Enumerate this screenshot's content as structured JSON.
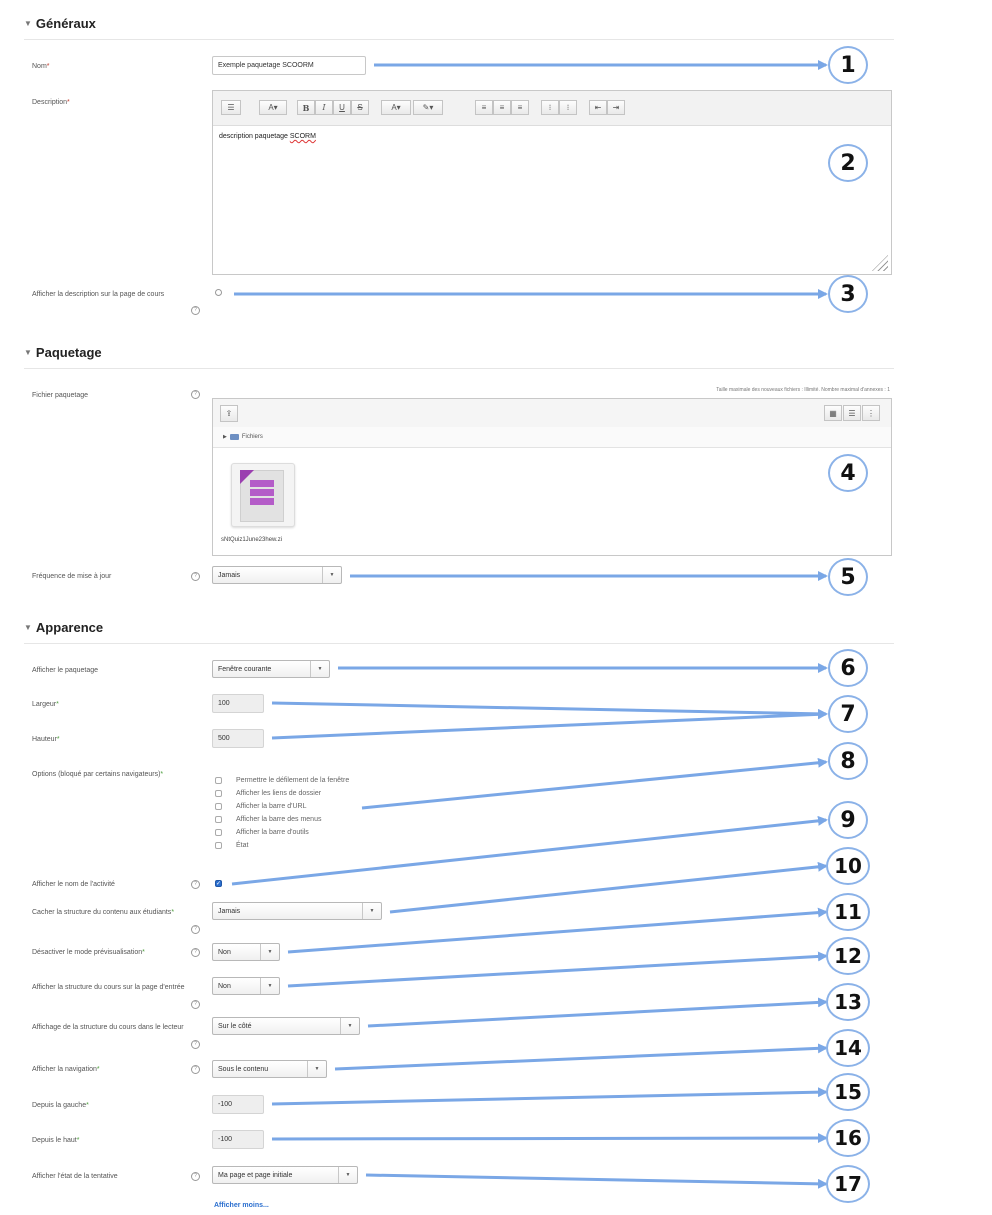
{
  "sections": {
    "generaux": "Généraux",
    "paquetage": "Paquetage",
    "apparence": "Apparence"
  },
  "fields": {
    "nom": {
      "label": "Nom",
      "value": "Exemple paquetage SCOORM"
    },
    "description": {
      "label": "Description",
      "content": "description paquetage",
      "content_underlined": "SCORM"
    },
    "show_description": {
      "label": "Afficher la description sur la page de cours"
    },
    "fichier": {
      "label": "Fichier paquetage",
      "limits": "Taille maximale des nouveaux fichiers : Illimité. Nombre maximal d'annexes : 1",
      "folder": "Fichiers",
      "file_name": "sNtQuiz1June23hew.zi"
    },
    "frequence": {
      "label": "Fréquence de mise à jour",
      "value": "Jamais"
    },
    "afficher_paquetage": {
      "label": "Afficher le paquetage",
      "value": "Fenêtre courante"
    },
    "largeur": {
      "label": "Largeur",
      "value": "100"
    },
    "hauteur": {
      "label": "Hauteur",
      "value": "500"
    },
    "options": {
      "label": "Options (bloqué par certains navigateurs)",
      "items": [
        "Permettre le défilement de la fenêtre",
        "Afficher les liens de dossier",
        "Afficher la barre d'URL",
        "Afficher la barre des menus",
        "Afficher la barre d'outils",
        "État"
      ]
    },
    "nom_activite": {
      "label": "Afficher le nom de l'activité"
    },
    "cacher_structure": {
      "label": "Cacher la structure du contenu aux étudiants",
      "value": "Jamais"
    },
    "desactiver_previsu": {
      "label": "Désactiver le mode prévisualisation",
      "value": "Non"
    },
    "structure_entree": {
      "label": "Afficher la structure du cours sur la page d'entrée",
      "value": "Non"
    },
    "affichage_lecteur": {
      "label": "Affichage de la structure du cours dans le lecteur",
      "value": "Sur le côté"
    },
    "navigation": {
      "label": "Afficher la navigation",
      "value": "Sous le contenu"
    },
    "depuis_gauche": {
      "label": "Depuis la gauche",
      "value": "-100"
    },
    "depuis_haut": {
      "label": "Depuis le haut",
      "value": "-100"
    },
    "etat_tentative": {
      "label": "Afficher l'état de la tentative",
      "value": "Ma page et page initiale"
    }
  },
  "show_less": "Afficher moins...",
  "callouts": [
    "1",
    "2",
    "3",
    "4",
    "5",
    "6",
    "7",
    "8",
    "9",
    "10",
    "11",
    "12",
    "13",
    "14",
    "15",
    "16",
    "17"
  ],
  "colors": {
    "arrow": "#7aa7e6",
    "circle_border": "#8bb2e8",
    "link": "#2b6fcf",
    "required": "#c0392b"
  }
}
